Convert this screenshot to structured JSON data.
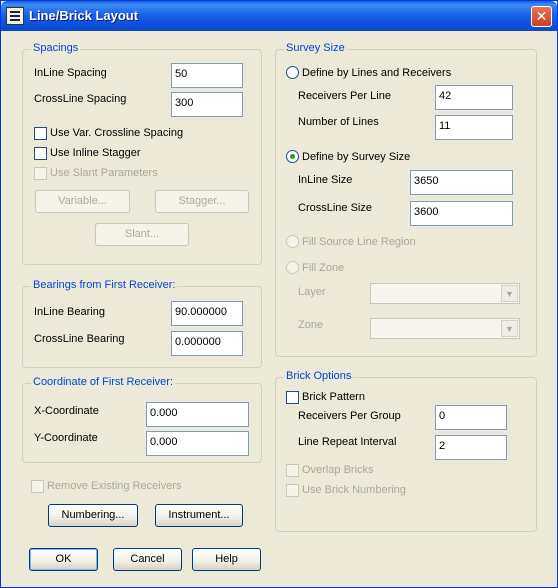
{
  "window": {
    "title": "Line/Brick Layout",
    "close_glyph": "✕"
  },
  "spacings": {
    "legend": "Spacings",
    "inline_label": "InLine Spacing",
    "inline_value": "50",
    "crossline_label": "CrossLine Spacing",
    "crossline_value": "300",
    "var_crossline_label": "Use Var. Crossline Spacing",
    "inline_stagger_label": "Use Inline Stagger",
    "slant_params_label": "Use Slant Parameters",
    "variable_btn": "Variable...",
    "stagger_btn": "Stagger...",
    "slant_btn": "Slant..."
  },
  "bearings": {
    "legend": "Bearings from First Receiver:",
    "inline_label": "InLine Bearing",
    "inline_value": "90.000000",
    "crossline_label": "CrossLine Bearing",
    "crossline_value": "0.000000"
  },
  "coordinate": {
    "legend": "Coordinate of First Receiver:",
    "x_label": "X-Coordinate",
    "x_value": "0.000",
    "y_label": "Y-Coordinate",
    "y_value": "0.000"
  },
  "bottom_left": {
    "remove_receivers_label": "Remove Existing Receivers",
    "numbering_btn": "Numbering...",
    "instrument_btn": "Instrument..."
  },
  "survey_size": {
    "legend": "Survey Size",
    "define_lines_label": "Define by Lines and Receivers",
    "receivers_per_line_label": "Receivers Per Line",
    "receivers_per_line_value": "42",
    "number_of_lines_label": "Number of Lines",
    "number_of_lines_value": "11",
    "define_survey_label": "Define by Survey Size",
    "inline_size_label": "InLine Size",
    "inline_size_value": "3650",
    "crossline_size_label": "CrossLine Size",
    "crossline_size_value": "3600",
    "fill_source_label": "Fill Source Line Region",
    "fill_zone_label": "Fill Zone",
    "layer_label": "Layer",
    "zone_label": "Zone",
    "dropdown_arrow": "▼"
  },
  "brick": {
    "legend": "Brick Options",
    "pattern_label": "Brick Pattern",
    "receivers_per_group_label": "Receivers Per Group",
    "receivers_per_group_value": "0",
    "line_repeat_label": "Line Repeat Interval",
    "line_repeat_value": "2",
    "overlap_label": "Overlap Bricks",
    "numbering_label": "Use Brick Numbering"
  },
  "footer": {
    "ok": "OK",
    "cancel": "Cancel",
    "help": "Help"
  },
  "colors": {
    "title_bar": "#0a48c8",
    "group_legend": "#0046d5",
    "disabled_text": "#aca899",
    "window_bg": "#ece9d8"
  }
}
